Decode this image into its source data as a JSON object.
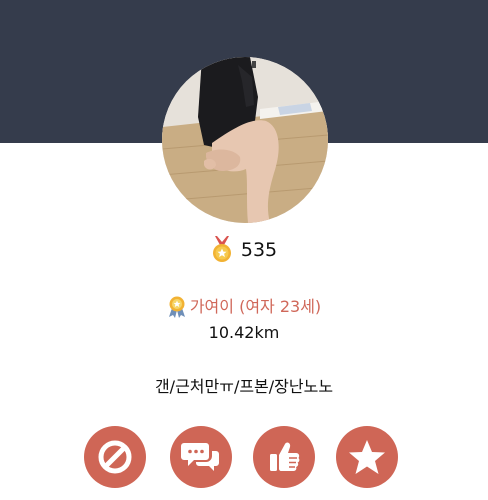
{
  "profile": {
    "points": "535",
    "name_line": "가여이 (여자 23세)",
    "distance": "10.42km",
    "bio": "갠/근처만ㅠ/프본/장난노노"
  },
  "icons": {
    "medal": "medal-icon",
    "badge": "badge-icon",
    "block": "block-icon",
    "chat": "chat-bubbles-icon",
    "like": "thumbs-up-icon",
    "favorite": "star-icon"
  },
  "colors": {
    "header": "#353c4c",
    "accent": "#cf6656",
    "name_text": "#d0685a"
  }
}
